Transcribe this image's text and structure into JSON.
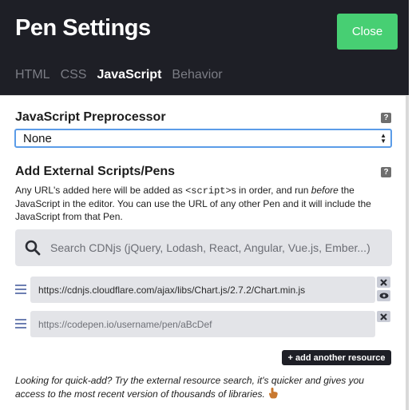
{
  "header": {
    "title": "Pen Settings",
    "close_label": "Close"
  },
  "tabs": [
    {
      "label": "HTML",
      "active": false
    },
    {
      "label": "CSS",
      "active": false
    },
    {
      "label": "JavaScript",
      "active": true
    },
    {
      "label": "Behavior",
      "active": false
    }
  ],
  "preprocessor": {
    "title": "JavaScript Preprocessor",
    "help": "?",
    "selected": "None"
  },
  "external": {
    "title": "Add External Scripts/Pens",
    "help": "?",
    "desc_1": "Any URL's added here will be added as ",
    "desc_code": "<script>",
    "desc_2": "s in order, and run ",
    "desc_em": "before",
    "desc_3": " the JavaScript in the editor. You can use the URL of any other Pen and it will include the JavaScript from that Pen.",
    "search_placeholder": "Search CDNjs (jQuery, Lodash, React, Angular, Vue.js, Ember...)",
    "resources": [
      {
        "value": "https://cdnjs.cloudflare.com/ajax/libs/Chart.js/2.7.2/Chart.min.js",
        "placeholder": ""
      },
      {
        "value": "",
        "placeholder": "https://codepen.io/username/pen/aBcDef"
      }
    ],
    "add_label": "+ add another resource",
    "quickadd": "Looking for quick-add? Try the external resource search, it's quicker and gives you access to the most recent version of thousands of libraries."
  },
  "colors": {
    "header_bg": "#1e1f26",
    "accent_green": "#47cf73",
    "select_border": "#5b9ce8",
    "field_bg": "#e3e4e8"
  }
}
